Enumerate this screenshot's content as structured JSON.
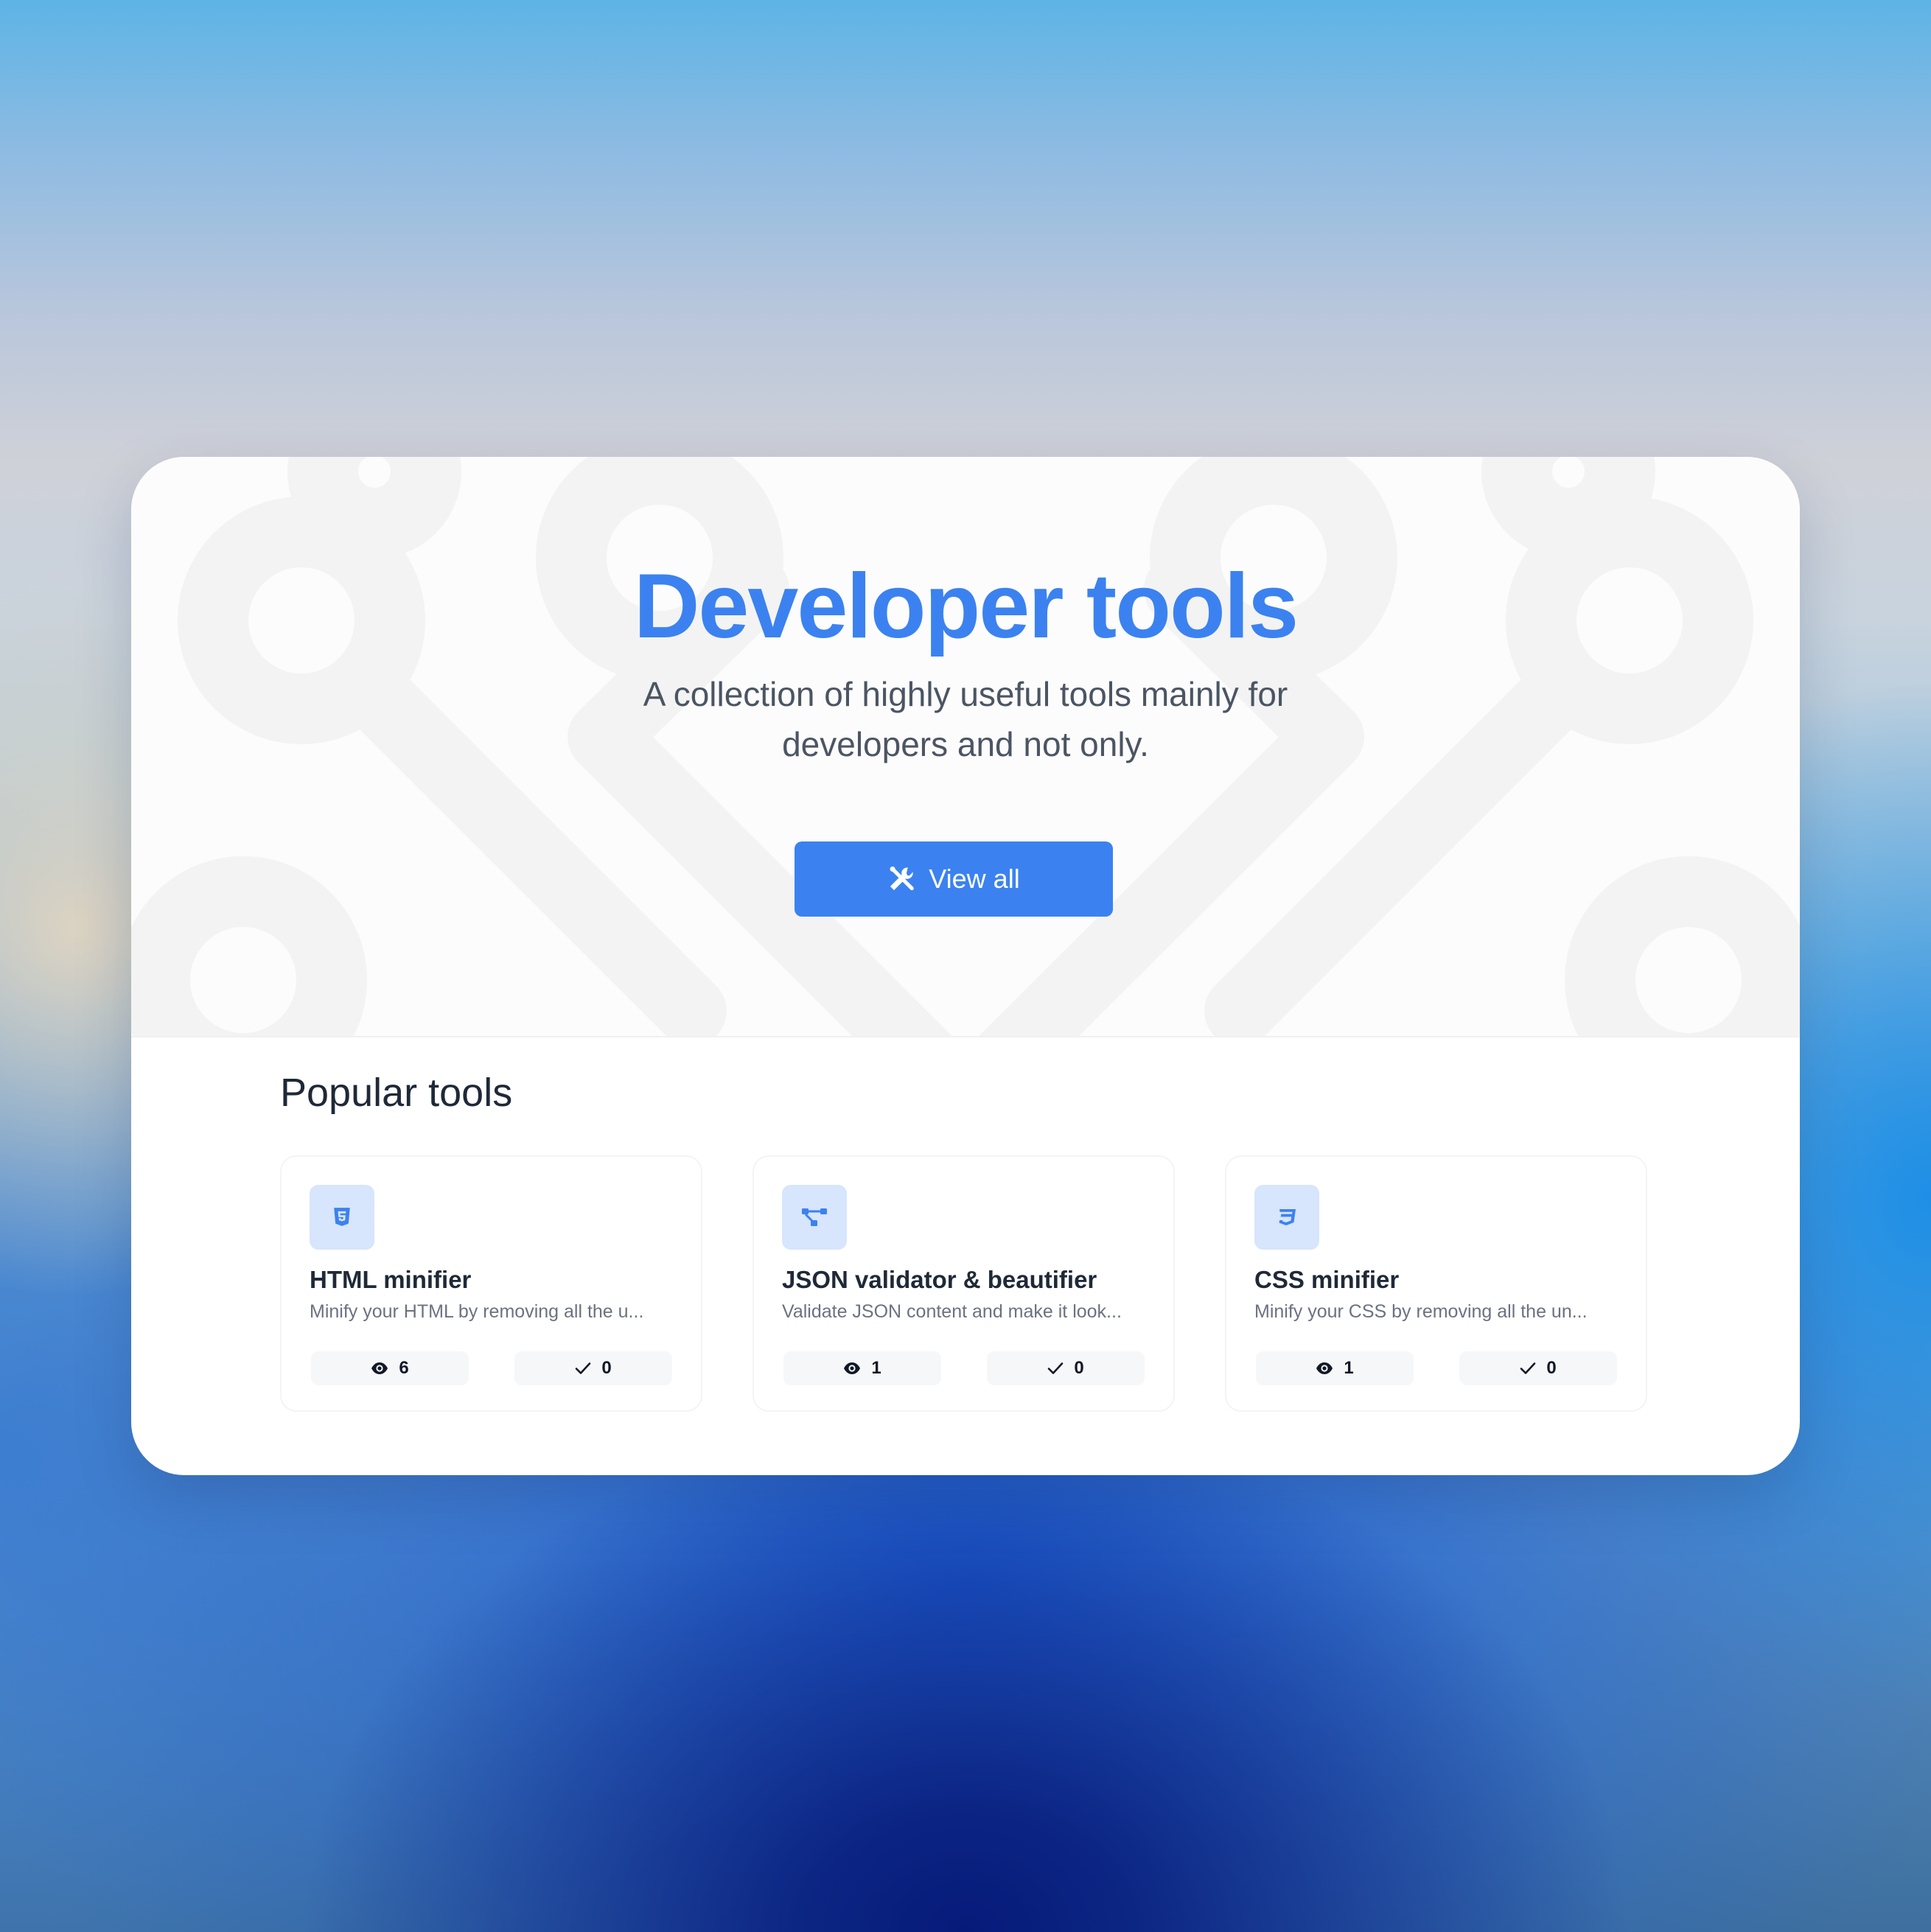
{
  "colors": {
    "accent": "#3b82f0",
    "icon_bg": "#d7e5fd",
    "text_dark": "#1f2937",
    "text_muted": "#6b7280"
  },
  "hero": {
    "title": "Developer tools",
    "subtitle": "A collection of highly useful tools mainly for developers and not only.",
    "button_icon": "tools-icon",
    "button_label": "View all"
  },
  "popular": {
    "title": "Popular tools",
    "tools": [
      {
        "icon": "html5-icon",
        "name": "HTML minifier",
        "description": "Minify your HTML by removing all the u...",
        "views": "6",
        "checks": "0"
      },
      {
        "icon": "diagram-icon",
        "name": "JSON validator & beautifier",
        "description": "Validate JSON content and make it look...",
        "views": "1",
        "checks": "0"
      },
      {
        "icon": "css3-icon",
        "name": "CSS minifier",
        "description": "Minify your CSS by removing all the un...",
        "views": "1",
        "checks": "0"
      }
    ]
  }
}
